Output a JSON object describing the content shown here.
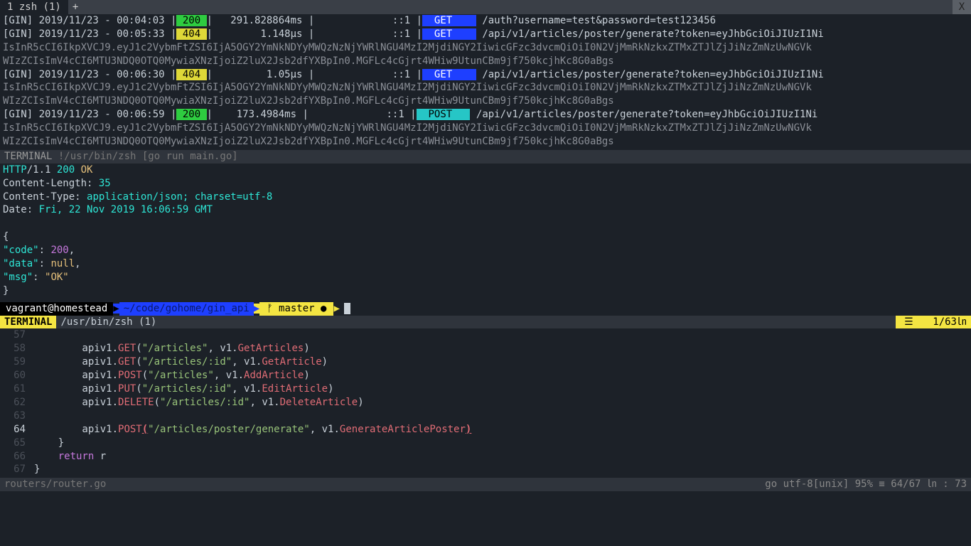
{
  "tab": {
    "title": "1 zsh (1)",
    "plus": "+",
    "close": "X"
  },
  "logs": [
    {
      "prefix": "[GIN] 2019/11/23 - 00:04:03 |",
      "status": " 200 ",
      "mid": "|   291.828864ms |             ::1 |",
      "method": "  GET    ",
      "path": " /auth?username=test&password=test123456"
    },
    {
      "prefix": "[GIN] 2019/11/23 - 00:05:33 |",
      "status": " 404 ",
      "mid": "|        1.148µs |             ::1 |",
      "method": "  GET    ",
      "path": " /api/v1/articles/poster/generate?token=eyJhbGciOiJIUzI1Ni"
    },
    {
      "prefix": "[GIN] 2019/11/23 - 00:06:30 |",
      "status": " 404 ",
      "mid": "|         1.05µs |             ::1 |",
      "method": "  GET    ",
      "path": " /api/v1/articles/poster/generate?token=eyJhbGciOiJIUzI1Ni"
    },
    {
      "prefix": "[GIN] 2019/11/23 - 00:06:59 |",
      "status": " 200 ",
      "mid": "|    173.4984ms |             ::1 |",
      "method": "  POST   ",
      "path": " /api/v1/articles/poster/generate?token=eyJhbGciOiJIUzI1Ni"
    }
  ],
  "token_wrap": [
    "IsInR5cCI6IkpXVCJ9.eyJ1c2VybmFtZSI6IjA5OGY2YmNkNDYyMWQzNzNjYWRlNGU4MzI2MjdiNGY2IiwicGFzc3dvcmQiOiI0N2VjMmRkNzkxZTMxZTJlZjJiNzZmNzUwNGVk",
    "WIzZCIsImV4cCI6MTU3NDQ0OTQ0MywiaXNzIjoiZ2luX2Jsb2dfYXBpIn0.MGFLc4cGjrt4WHiw9UtunCBm9jf750kcjhKc8G0aBgs"
  ],
  "statusbar1": {
    "label": " TERMINAL ",
    "text": " !/usr/bin/zsh [go run main.go]"
  },
  "http": {
    "proto": "HTTP",
    "ver": "/1.1 ",
    "code": "200 ",
    "ok": "OK",
    "hdr_cl": "Content-Length: ",
    "cl_val": "35",
    "hdr_ct": "Content-Type: ",
    "ct_val": "application/json; charset=utf-8",
    "hdr_date": "Date: ",
    "date_val": "Fri, 22 Nov 2019 16:06:59 GMT"
  },
  "json": {
    "open": "{",
    "k1": "\"code\"",
    "v1": "200",
    "k2": "\"data\"",
    "v2": "null",
    "k3": "\"msg\"",
    "v3": "\"OK\"",
    "close": "}"
  },
  "prompt": {
    "user": " vagrant@homestead ",
    "path": " ~/code/gohome/gin_api ",
    "branch": " ᚠ master ● "
  },
  "statusbar2": {
    "term": " TERMINAL ",
    "path": " /usr/bin/zsh (1)",
    "pos": "1",
    "total": "/63",
    "ln": " ㏑"
  },
  "editor": {
    "lines": [
      {
        "n": "57",
        "segs": []
      },
      {
        "n": "58",
        "segs": [
          [
            "var",
            "        apiv1."
          ],
          [
            "method",
            "GET"
          ],
          [
            "var",
            "("
          ],
          [
            "string",
            "\"/articles\""
          ],
          [
            "var",
            ", v1."
          ],
          [
            "method",
            "GetArticles"
          ],
          [
            "var",
            ")"
          ]
        ]
      },
      {
        "n": "59",
        "segs": [
          [
            "var",
            "        apiv1."
          ],
          [
            "method",
            "GET"
          ],
          [
            "var",
            "("
          ],
          [
            "string",
            "\"/articles/:id\""
          ],
          [
            "var",
            ", v1."
          ],
          [
            "method",
            "GetArticle"
          ],
          [
            "var",
            ")"
          ]
        ]
      },
      {
        "n": "60",
        "segs": [
          [
            "var",
            "        apiv1."
          ],
          [
            "method",
            "POST"
          ],
          [
            "var",
            "("
          ],
          [
            "string",
            "\"/articles\""
          ],
          [
            "var",
            ", v1."
          ],
          [
            "method",
            "AddArticle"
          ],
          [
            "var",
            ")"
          ]
        ]
      },
      {
        "n": "61",
        "segs": [
          [
            "var",
            "        apiv1."
          ],
          [
            "method",
            "PUT"
          ],
          [
            "var",
            "("
          ],
          [
            "string",
            "\"/articles/:id\""
          ],
          [
            "var",
            ", v1."
          ],
          [
            "method",
            "EditArticle"
          ],
          [
            "var",
            ")"
          ]
        ]
      },
      {
        "n": "62",
        "segs": [
          [
            "var",
            "        apiv1."
          ],
          [
            "method",
            "DELETE"
          ],
          [
            "var",
            "("
          ],
          [
            "string",
            "\"/articles/:id\""
          ],
          [
            "var",
            ", v1."
          ],
          [
            "method",
            "DeleteArticle"
          ],
          [
            "var",
            ")"
          ]
        ]
      },
      {
        "n": "63",
        "segs": []
      },
      {
        "n": "64",
        "cur": true,
        "segs": [
          [
            "var",
            "        apiv1."
          ],
          [
            "method",
            "POST"
          ],
          [
            "paren-hl",
            "("
          ],
          [
            "string",
            "\"/articles/poster/generate\""
          ],
          [
            "var",
            ", v1."
          ],
          [
            "method",
            "GenerateArticlePoster"
          ],
          [
            "paren-hl",
            ")"
          ]
        ]
      },
      {
        "n": "65",
        "segs": [
          [
            "var",
            "    }"
          ]
        ]
      },
      {
        "n": "66",
        "segs": [
          [
            "var",
            "    "
          ],
          [
            "kw",
            "return"
          ],
          [
            "var",
            " r"
          ]
        ]
      },
      {
        "n": "67",
        "segs": [
          [
            "var",
            "}"
          ]
        ]
      }
    ]
  },
  "statusbar3": {
    "file": "routers/router.go",
    "right": "go  utf-8[unix]   95% ≡  64/67 ㏑ :  73"
  }
}
